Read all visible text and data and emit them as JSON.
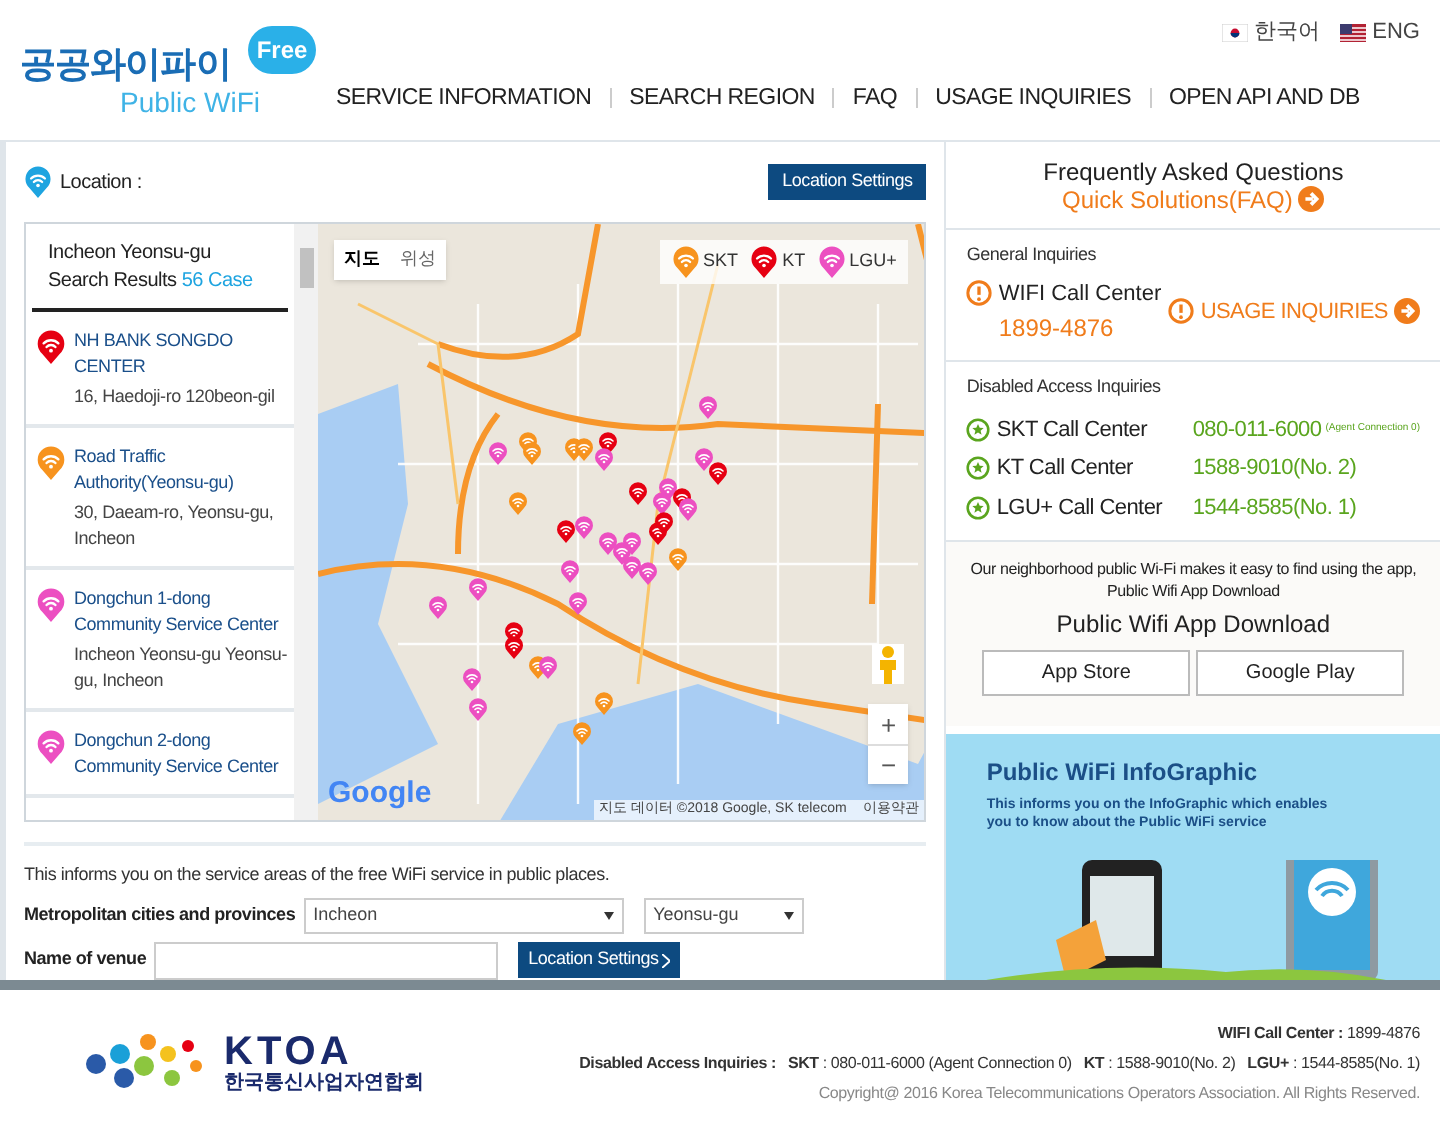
{
  "header": {
    "logo_korean": "공공와이파이",
    "logo_badge": "Free",
    "logo_english": "Public WiFi",
    "languages": [
      {
        "label": "한국어",
        "kind": "kr"
      },
      {
        "label": "ENG",
        "kind": "us"
      }
    ],
    "nav": [
      "SERVICE INFORMATION",
      "SEARCH REGION",
      "FAQ",
      "USAGE INQUIRIES",
      "OPEN API AND DB"
    ]
  },
  "location": {
    "label": "Location :",
    "button": "Location Settings"
  },
  "results": {
    "region": "Incheon Yeonsu-gu",
    "label": "Search Results",
    "count": "56 Case"
  },
  "places": [
    {
      "name": "NH BANK SONGDO CENTER",
      "address": "16, Haedoji-ro 120beon-gil",
      "color": "#e60012"
    },
    {
      "name": "Road Traffic Authority(Yeonsu-gu)",
      "address": "30, Daeam-ro, Yeonsu-gu, Incheon",
      "color": "#f7931e"
    },
    {
      "name": "Dongchun 1-dong Community Service Center",
      "address": "Incheon Yeonsu-gu Yeonsu-gu, Incheon",
      "color": "#ec4fc1"
    },
    {
      "name": "Dongchun 2-dong Community Service Center",
      "color": "#ec4fc1"
    }
  ],
  "map": {
    "tabs": [
      {
        "label": "지도",
        "selected": true
      },
      {
        "label": "위성",
        "selected": false
      }
    ],
    "legend": [
      {
        "label": "SKT",
        "color": "#f7931e"
      },
      {
        "label": "KT",
        "color": "#e60012"
      },
      {
        "label": "LGU+",
        "color": "#ec4fc1"
      }
    ],
    "zoom_in": "+",
    "zoom_out": "−",
    "logo": "Google",
    "attribution": "지도 데이터 ©2018 Google, SK telecom",
    "terms": "이용약관"
  },
  "search_form": {
    "note": "This informs you on the service areas of the free WiFi service in public places.",
    "region_label": "Metropolitan cities and provinces",
    "city": "Incheon",
    "district": "Yeonsu-gu",
    "venue_label": "Name of venue",
    "button": "Location Settings"
  },
  "faq": {
    "title": "Frequently Asked Questions",
    "link": "Quick Solutions(FAQ)"
  },
  "general": {
    "heading": "General Inquiries",
    "center": "WIFI Call Center",
    "phone": "1899-4876",
    "link": "USAGE INQUIRIES"
  },
  "disabled": {
    "heading": "Disabled Access Inquiries",
    "centers": [
      {
        "name": "SKT Call Center",
        "phone": "080-011-6000",
        "note": "(Agent Connection 0)"
      },
      {
        "name": "KT Call Center",
        "phone": "1588-9010(No. 2)"
      },
      {
        "name": "LGU+ Call Center",
        "phone": "1544-8585(No. 1)"
      }
    ]
  },
  "app": {
    "text": "Our neighborhood public Wi-Fi makes it easy to find using the app, Public Wifi App Download",
    "title": "Public Wifi App Download",
    "buttons": [
      "App Store",
      "Google Play"
    ]
  },
  "infographic": {
    "title": "Public WiFi InfoGraphic",
    "text": "This informs you on the InfoGraphic which enables you to know about the Public WiFi service"
  },
  "footer": {
    "logo": "KTOA",
    "logo_korean": "한국통신사업자연합회",
    "call_center_label": "WIFI Call Center :",
    "call_center": "1899-4876",
    "disabled_label": "Disabled Access Inquiries :",
    "disabled": [
      {
        "label": "SKT",
        "value": ": 080-011-6000 (Agent Connection 0)"
      },
      {
        "label": "KT",
        "value": ": 1588-9010(No. 2)"
      },
      {
        "label": "LGU+",
        "value": ": 1544-8585(No. 1)"
      }
    ],
    "copyright": "Copyright@ 2016 Korea Telecommunications Operators Association. All Rights Reserved."
  }
}
